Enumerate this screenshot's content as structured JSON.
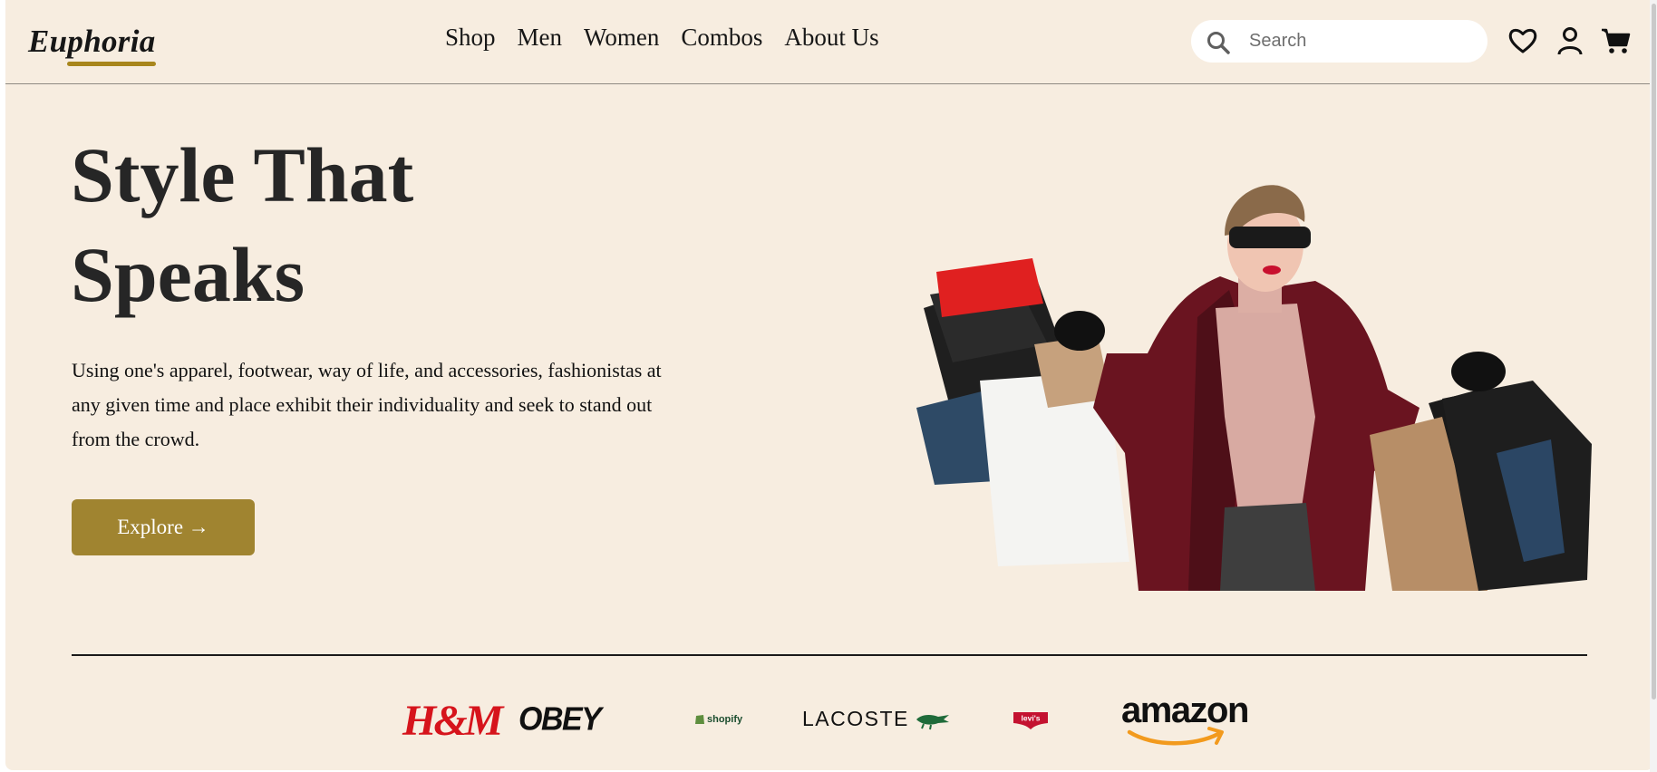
{
  "brand": {
    "name": "Euphoria",
    "accent_color": "#a8861c",
    "background_color": "#f7ede0"
  },
  "nav": {
    "items": [
      "Shop",
      "Men",
      "Women",
      "Combos",
      "About Us"
    ]
  },
  "search": {
    "placeholder": "Search",
    "value": "",
    "icon": "search-icon"
  },
  "header_icons": [
    "heart-icon",
    "user-icon",
    "cart-icon"
  ],
  "hero": {
    "title_line1": "Style That",
    "title_line2": "Speaks",
    "description": "Using one's apparel, footwear, way of life, and accessories, fashionistas at any given time and place exhibit their individuality and seek to stand out from the crowd.",
    "cta_label": "Explore →",
    "cta_color": "#a08430"
  },
  "brands": {
    "hm": "H&M",
    "obey": "OBEY",
    "shopify": "shopify",
    "lacoste": "LACOSTE",
    "levis": "levi's",
    "amazon": "amazon"
  }
}
